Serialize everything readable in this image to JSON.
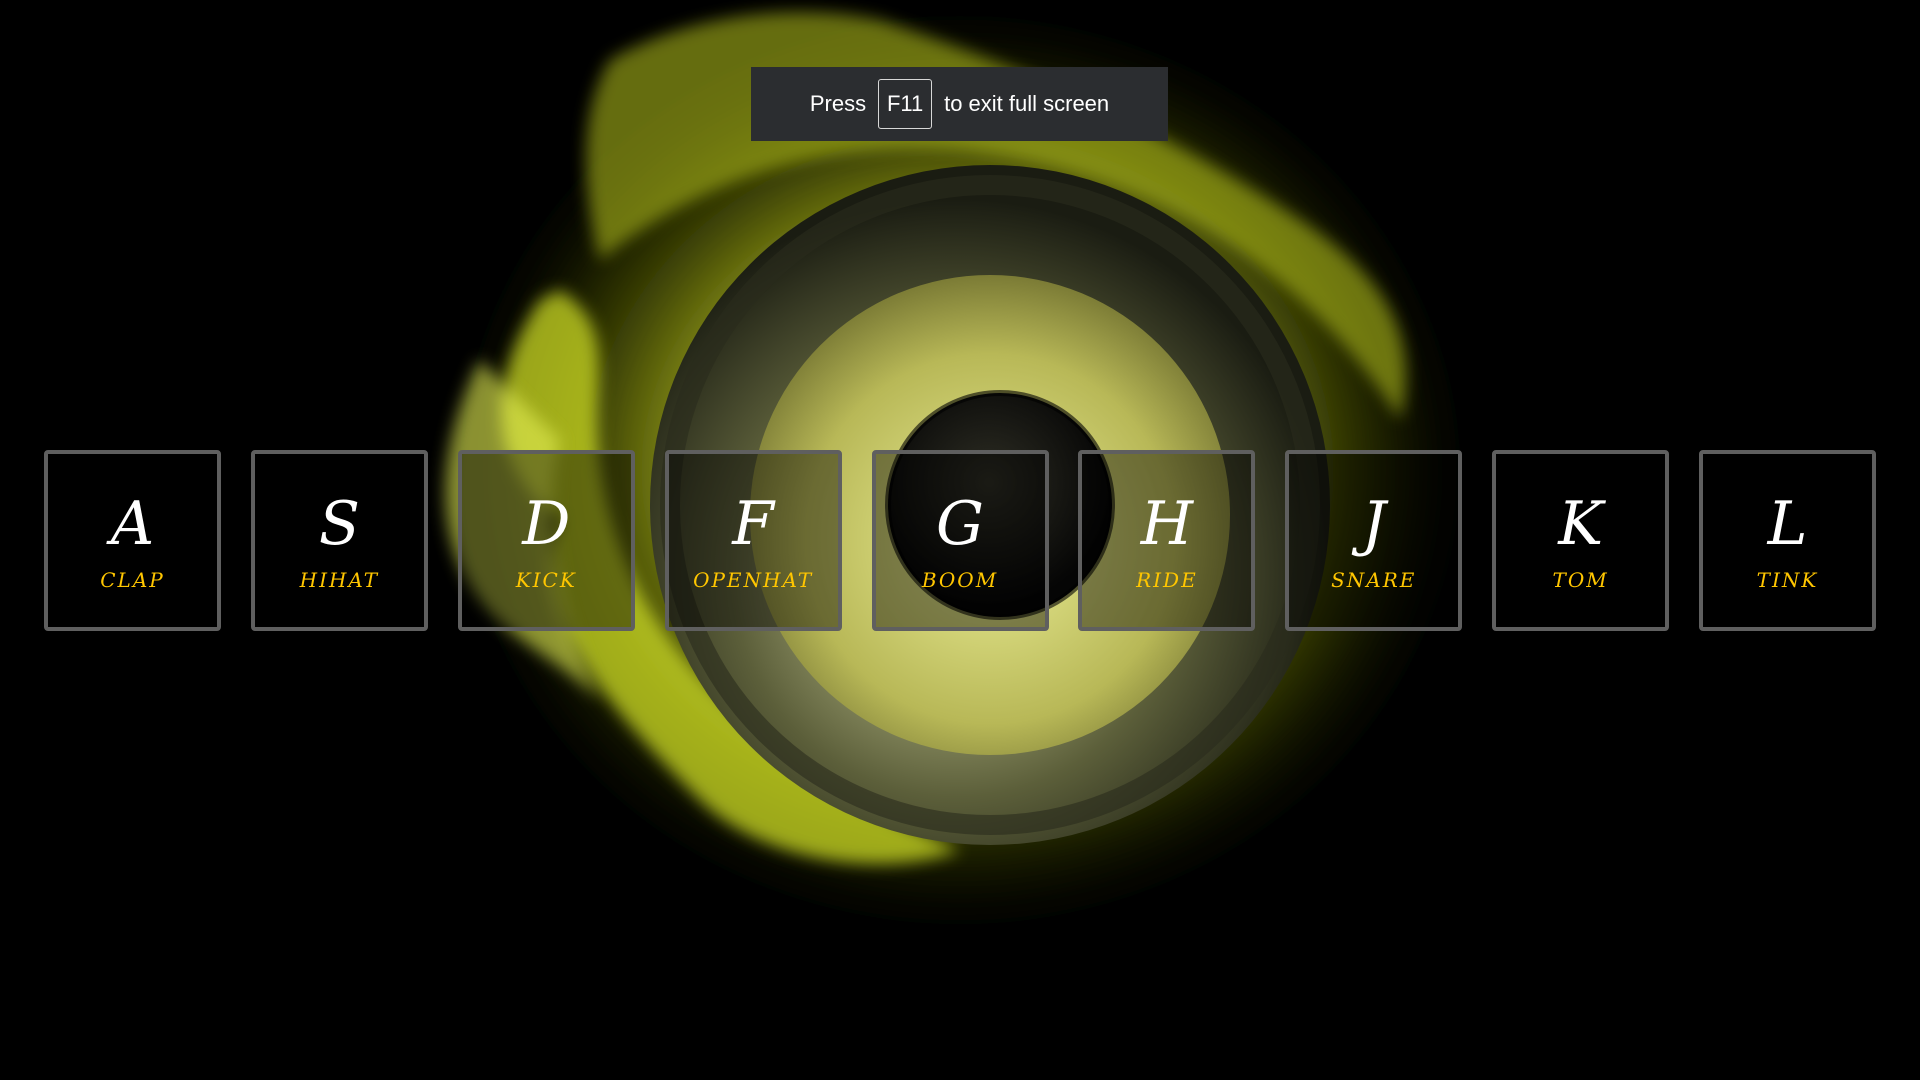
{
  "fullscreen_notice": {
    "prefix": "Press",
    "key": "F11",
    "suffix": "to exit full screen"
  },
  "keys": [
    {
      "letter": "A",
      "sound": "CLAP"
    },
    {
      "letter": "S",
      "sound": "HIHAT"
    },
    {
      "letter": "D",
      "sound": "KICK"
    },
    {
      "letter": "F",
      "sound": "OPENHAT"
    },
    {
      "letter": "G",
      "sound": "BOOM"
    },
    {
      "letter": "H",
      "sound": "RIDE"
    },
    {
      "letter": "J",
      "sound": "SNARE"
    },
    {
      "letter": "K",
      "sound": "TOM"
    },
    {
      "letter": "L",
      "sound": "TINK"
    }
  ],
  "colors": {
    "background": "#000000",
    "key_border": "#5f5f5f",
    "key_letter": "#ffffff",
    "key_sound": "#ffc600",
    "speaker_glow": "#e8f23a"
  }
}
